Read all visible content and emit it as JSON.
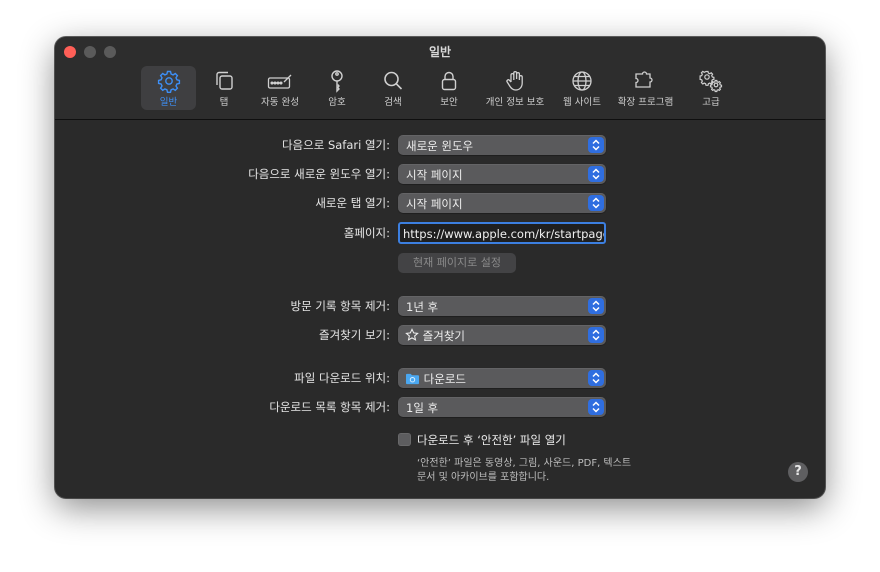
{
  "window": {
    "title": "일반"
  },
  "toolbar": {
    "tabs": [
      {
        "label": "일반",
        "icon": "gear-icon",
        "active": true
      },
      {
        "label": "탭",
        "icon": "tabs-icon",
        "active": false
      },
      {
        "label": "자동 완성",
        "icon": "autofill-icon",
        "active": false
      },
      {
        "label": "암호",
        "icon": "key-icon",
        "active": false
      },
      {
        "label": "검색",
        "icon": "search-icon",
        "active": false
      },
      {
        "label": "보안",
        "icon": "lock-icon",
        "active": false
      },
      {
        "label": "개인 정보 보호",
        "icon": "hand-icon",
        "active": false
      },
      {
        "label": "웹 사이트",
        "icon": "globe-icon",
        "active": false
      },
      {
        "label": "확장 프로그램",
        "icon": "puzzle-icon",
        "active": false
      },
      {
        "label": "고급",
        "icon": "gears-icon",
        "active": false
      }
    ]
  },
  "settings": {
    "open_safari": {
      "label": "다음으로 Safari 열기:",
      "value": "새로운 윈도우"
    },
    "new_window": {
      "label": "다음으로 새로운 윈도우 열기:",
      "value": "시작 페이지"
    },
    "new_tab": {
      "label": "새로운 탭 열기:",
      "value": "시작 페이지"
    },
    "homepage": {
      "label": "홈페이지:",
      "value": "https://www.apple.com/kr/startpage/"
    },
    "set_current_button": "현재 페이지로 설정",
    "remove_history": {
      "label": "방문 기록 항목 제거:",
      "value": "1년 후"
    },
    "favorites": {
      "label": "즐겨찾기 보기:",
      "value": "즐겨찾기",
      "icon": "star-icon"
    },
    "download_location": {
      "label": "파일 다운로드 위치:",
      "value": "다운로드",
      "icon": "folder-icon"
    },
    "remove_downloads": {
      "label": "다운로드 목록 항목 제거:",
      "value": "1일 후"
    },
    "open_safe_files": {
      "label": "다운로드 후 ‘안전한’ 파일 열기",
      "checked": false,
      "description_line1": "‘안전한’ 파일은 동영상, 그림, 사운드, PDF, 텍스트",
      "description_line2": "문서 및 아카이브를 포함합니다."
    },
    "help": "?"
  },
  "colors": {
    "accent": "#3d8ff6",
    "chevron_button": "#2f6ee0",
    "close": "#ff5f57"
  }
}
